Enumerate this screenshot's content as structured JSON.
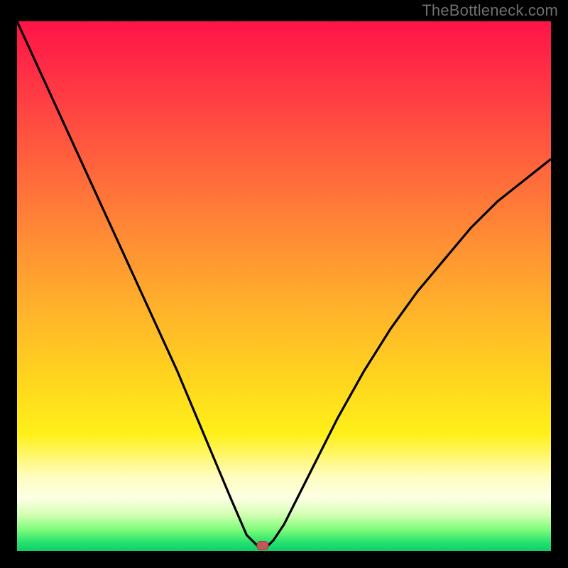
{
  "watermark": "TheBottleneck.com",
  "colors": {
    "frame": "#000000",
    "curve": "#000000",
    "marker": "#c05858",
    "gradient_stops": [
      "#ff1447",
      "#ff2a46",
      "#ff5a3e",
      "#ff8a35",
      "#ffb42a",
      "#ffd61e",
      "#fff01a",
      "#fffdc0",
      "#fdffe4",
      "#d7ffb6",
      "#7dfc7a",
      "#22e06e",
      "#11cf6a"
    ]
  },
  "chart_data": {
    "type": "line",
    "title": "",
    "xlabel": "",
    "ylabel": "",
    "xlim": [
      0,
      100
    ],
    "ylim": [
      0,
      100
    ],
    "grid": false,
    "legend": false,
    "series": [
      {
        "name": "bottleneck-curve",
        "x": [
          0,
          5,
          10,
          15,
          20,
          25,
          30,
          35,
          40,
          43,
          45,
          46,
          47,
          48,
          50,
          55,
          60,
          65,
          70,
          75,
          80,
          85,
          90,
          95,
          100
        ],
        "values": [
          100,
          89,
          78,
          67,
          56,
          45,
          34,
          22,
          10,
          3,
          1,
          1,
          1,
          2,
          5,
          15,
          25,
          34,
          42,
          49,
          55,
          61,
          66,
          70,
          74
        ]
      }
    ],
    "marker": {
      "x": 46,
      "y": 1,
      "label": ""
    }
  }
}
